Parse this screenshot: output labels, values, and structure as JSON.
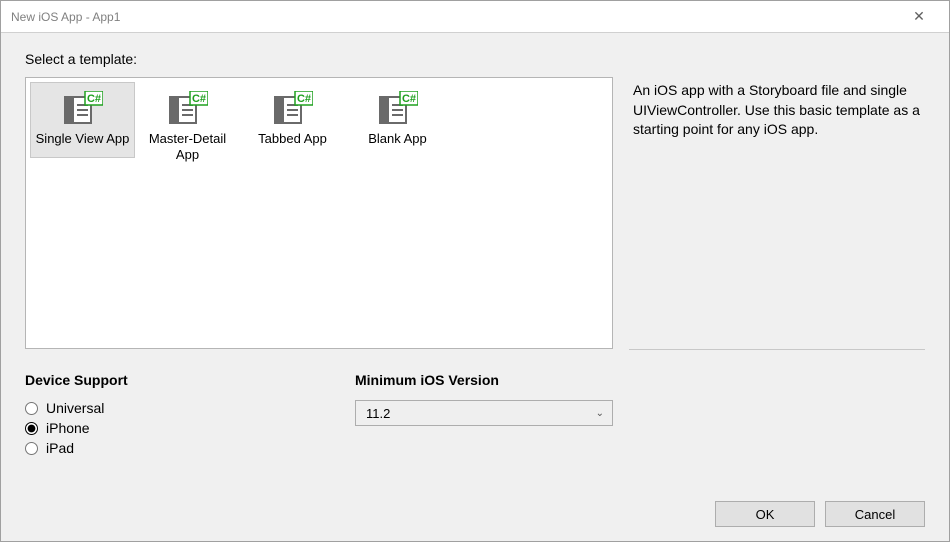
{
  "window": {
    "title": "New iOS App - App1"
  },
  "prompt": "Select a template:",
  "templates": [
    {
      "label": "Single View App",
      "selected": true
    },
    {
      "label": "Master-Detail App",
      "selected": false
    },
    {
      "label": "Tabbed App",
      "selected": false
    },
    {
      "label": "Blank App",
      "selected": false
    }
  ],
  "description": "An iOS app with a Storyboard file and single UIViewController. Use this basic template as a starting point for any iOS app.",
  "device_support": {
    "heading": "Device Support",
    "options": [
      {
        "label": "Universal",
        "checked": false
      },
      {
        "label": "iPhone",
        "checked": true
      },
      {
        "label": "iPad",
        "checked": false
      }
    ]
  },
  "min_version": {
    "heading": "Minimum iOS Version",
    "selected": "11.2"
  },
  "buttons": {
    "ok": "OK",
    "cancel": "Cancel"
  }
}
